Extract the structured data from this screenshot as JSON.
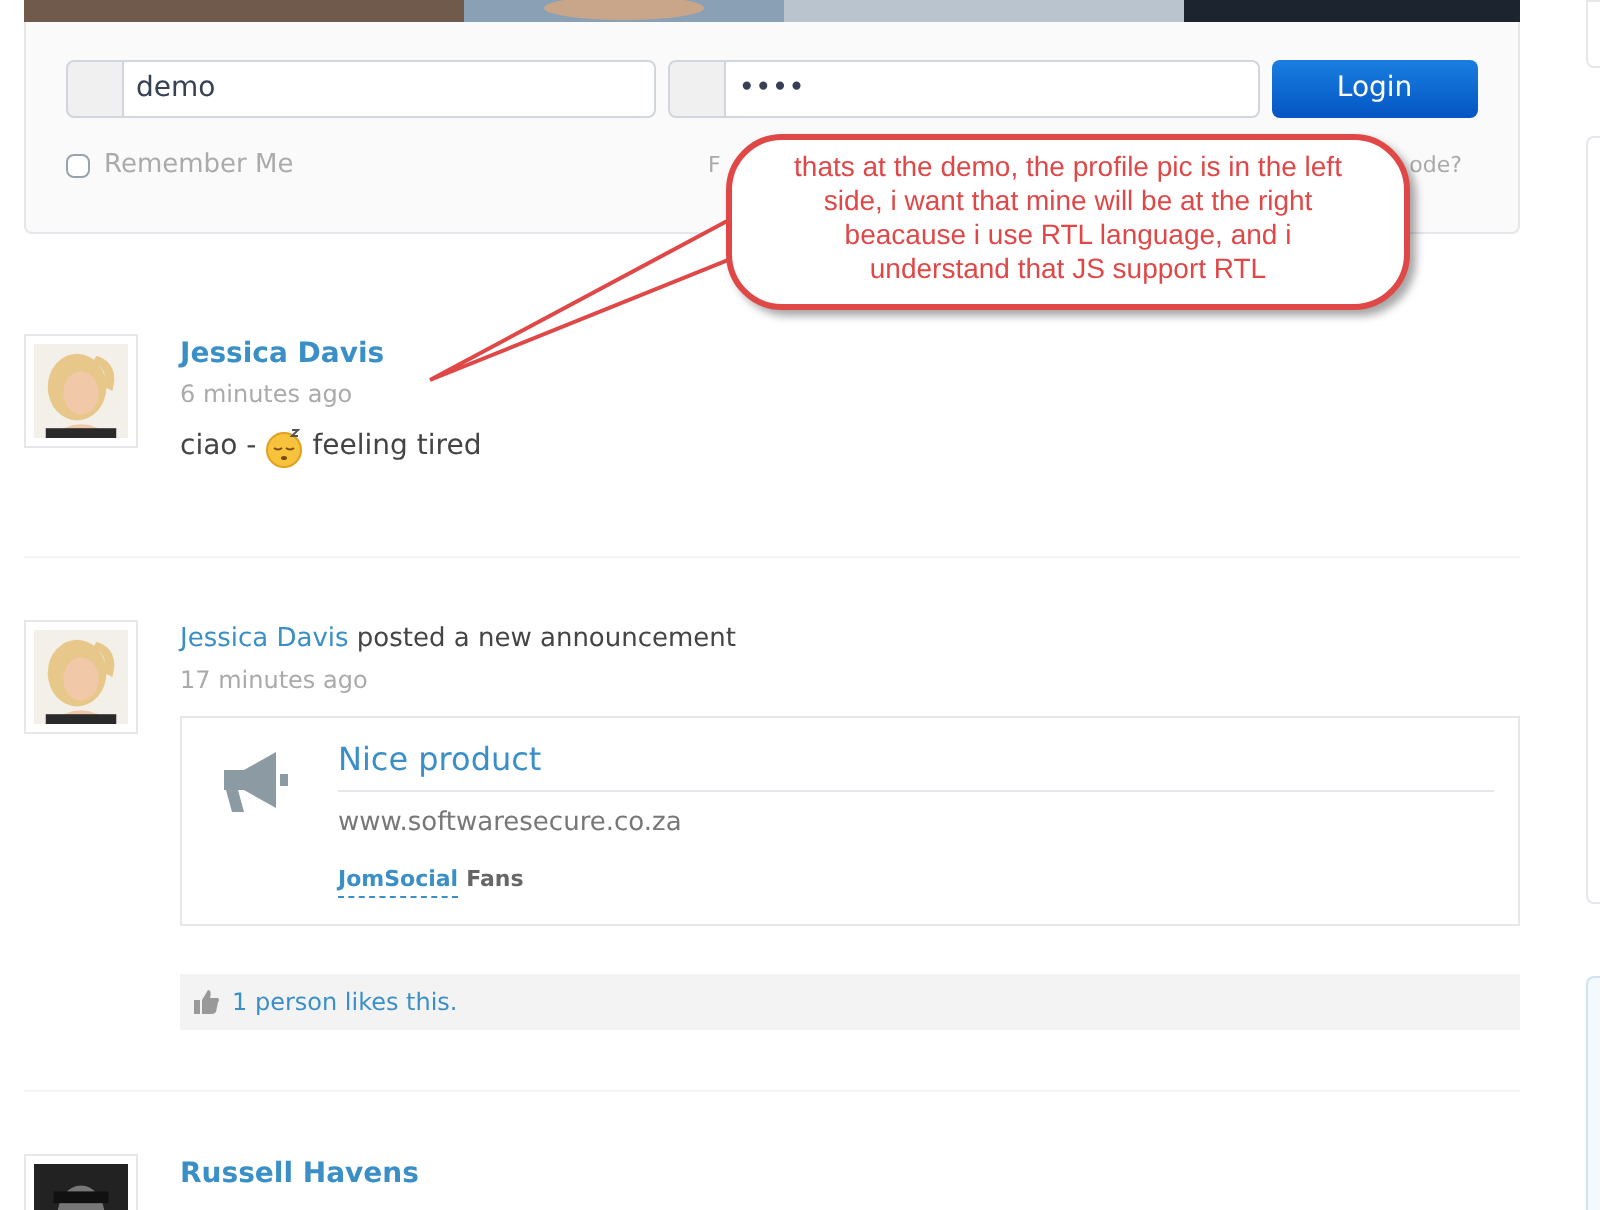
{
  "login": {
    "username": "demo",
    "password": "••••",
    "button": "Login",
    "remember_label": "Remember Me",
    "remember_checked": false,
    "forgot_left": "F",
    "forgot_right": "ode?"
  },
  "callout": {
    "text": "thats at the demo, the profile pic is in the left side, i want that mine will be at the right beacause i use RTL language, and i understand that JS support RTL"
  },
  "posts": [
    {
      "kind": "status",
      "author": "Jessica Davis",
      "time": "6 minutes ago",
      "status_before": "ciao -",
      "status_after": "feeling tired"
    },
    {
      "kind": "announcement",
      "author": "Jessica Davis",
      "action": "posted a new announcement",
      "time": "17 minutes ago",
      "title": "Nice product",
      "body": "www.softwaresecure.co.za",
      "group_link": "JomSocial",
      "group_suffix": "Fans",
      "likes": "1 person likes this."
    },
    {
      "kind": "status",
      "author": "Russell Havens"
    }
  ]
}
